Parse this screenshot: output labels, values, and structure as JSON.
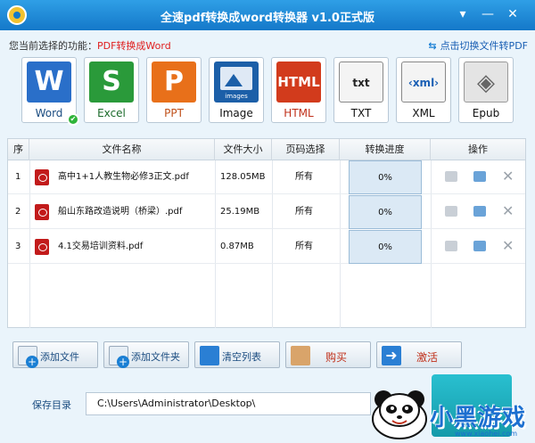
{
  "window": {
    "title": "全速pdf转换成word转换器 v1.0正式版",
    "min_glyph": "—",
    "close_glyph": "✕",
    "menu_glyph": "▾"
  },
  "current_function": {
    "label": "您当前选择的功能：",
    "value": "PDF转换成Word"
  },
  "switch_link": "点击切换文件转PDF",
  "formats": [
    {
      "label": "Word",
      "icon": "word-icon",
      "glyph": "W",
      "color": "#2a6fc9"
    },
    {
      "label": "Excel",
      "icon": "excel-icon",
      "glyph": "S",
      "color": "#2a9a3a"
    },
    {
      "label": "PPT",
      "icon": "ppt-icon",
      "glyph": "P",
      "color": "#e8701a"
    },
    {
      "label": "Image",
      "icon": "image-icon",
      "glyph": "▲",
      "color": "#1c5fa8",
      "sub": "images"
    },
    {
      "label": "HTML",
      "icon": "html-icon",
      "glyph": "HTML",
      "color": "#d23b1c"
    },
    {
      "label": "TXT",
      "icon": "txt-icon",
      "glyph": "txt",
      "color": "#ffffff"
    },
    {
      "label": "XML",
      "icon": "xml-icon",
      "glyph": "‹xml›",
      "color": "#ffffff"
    },
    {
      "label": "Epub",
      "icon": "epub-icon",
      "glyph": "◈",
      "color": "#e8e8e8"
    }
  ],
  "table": {
    "headers": [
      "序",
      "文件名称",
      "文件大小",
      "页码选择",
      "转换进度",
      "操作"
    ],
    "rows": [
      {
        "idx": "1",
        "name": "高中1+1人教生物必修3正文.pdf",
        "size": "128.05MB",
        "pages": "所有",
        "progress": "0%"
      },
      {
        "idx": "2",
        "name": "船山东路改造说明（桥梁）.pdf",
        "size": "25.19MB",
        "pages": "所有",
        "progress": "0%"
      },
      {
        "idx": "3",
        "name": "4.1交易培训资料.pdf",
        "size": "0.87MB",
        "pages": "所有",
        "progress": "0%"
      }
    ]
  },
  "buttons": {
    "add_file": "添加文件",
    "add_folder": "添加文件夹",
    "clear_list": "清空列表",
    "buy": "购买",
    "activate": "激活"
  },
  "save": {
    "label": "保存目录",
    "path": "C:\\Users\\Administrator\\Desktop\\"
  },
  "watermark": {
    "text": "小黑游戏",
    "sub": "www.xiaohei.com"
  }
}
